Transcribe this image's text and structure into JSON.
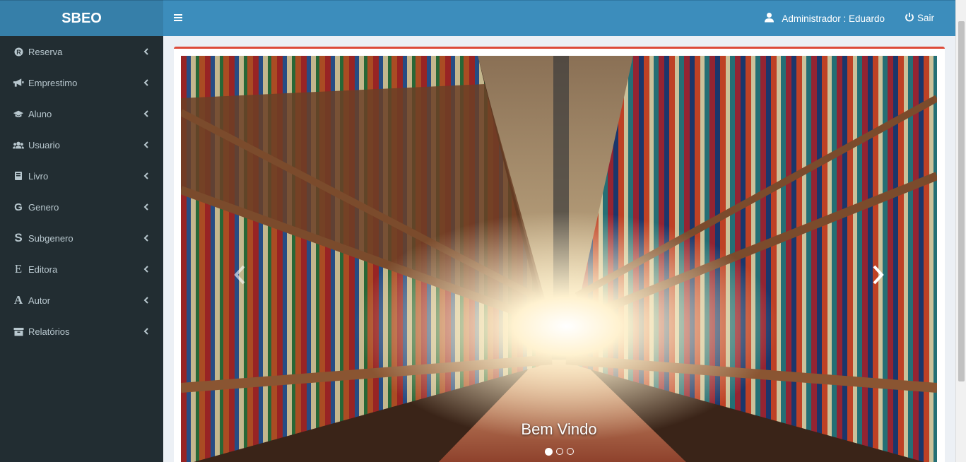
{
  "app": {
    "logo": "SBEO"
  },
  "sidebar": {
    "items": [
      {
        "label": "Reserva",
        "icon": "registered-icon"
      },
      {
        "label": "Emprestimo",
        "icon": "bullhorn-icon"
      },
      {
        "label": "Aluno",
        "icon": "graduation-cap-icon"
      },
      {
        "label": "Usuario",
        "icon": "users-icon"
      },
      {
        "label": "Livro",
        "icon": "book-icon"
      },
      {
        "label": "Genero",
        "icon": "g-letter-icon"
      },
      {
        "label": "Subgenero",
        "icon": "s-letter-icon"
      },
      {
        "label": "Editora",
        "icon": "e-letter-icon"
      },
      {
        "label": "Autor",
        "icon": "a-letter-icon"
      },
      {
        "label": "Relatórios",
        "icon": "archive-icon"
      }
    ]
  },
  "header": {
    "user_label": "Administrador : Eduardo",
    "logout_label": "Sair"
  },
  "carousel": {
    "caption": "Bem Vindo",
    "slide_count": 3,
    "active_slide": 1
  },
  "colors": {
    "header": "#3c8dbc",
    "logo": "#367fa9",
    "sidebar": "#222d32",
    "box_border": "#dd4b39"
  }
}
